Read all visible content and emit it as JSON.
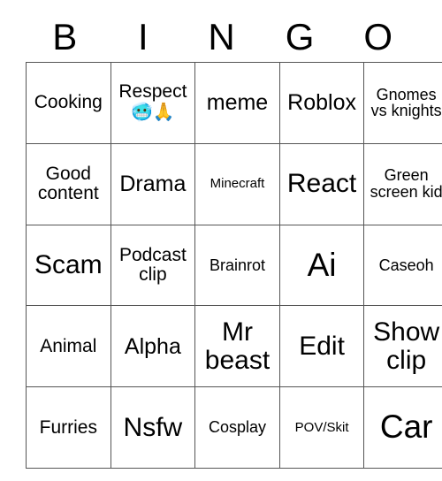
{
  "card": {
    "header_letters": [
      "B",
      "I",
      "N",
      "G",
      "O"
    ],
    "rows": [
      [
        {
          "text": "Cooking",
          "size": "fs-m",
          "emoji": ""
        },
        {
          "text": "Respect",
          "size": "fs-m",
          "emoji": "🥶🙏"
        },
        {
          "text": "meme",
          "size": "fs-l",
          "emoji": ""
        },
        {
          "text": "Roblox",
          "size": "fs-l",
          "emoji": ""
        },
        {
          "text": "Gnomes vs knights",
          "size": "fs-s",
          "emoji": ""
        }
      ],
      [
        {
          "text": "Good content",
          "size": "fs-m",
          "emoji": ""
        },
        {
          "text": "Drama",
          "size": "fs-l",
          "emoji": ""
        },
        {
          "text": "Minecraft",
          "size": "fs-xs",
          "emoji": ""
        },
        {
          "text": "React",
          "size": "fs-xl",
          "emoji": ""
        },
        {
          "text": "Green screen kid",
          "size": "fs-s",
          "emoji": ""
        }
      ],
      [
        {
          "text": "Scam",
          "size": "fs-xl",
          "emoji": ""
        },
        {
          "text": "Podcast clip",
          "size": "fs-m",
          "emoji": ""
        },
        {
          "text": "Brainrot",
          "size": "fs-s",
          "emoji": ""
        },
        {
          "text": "Ai",
          "size": "fs-xxl",
          "emoji": ""
        },
        {
          "text": "Caseoh",
          "size": "fs-s",
          "emoji": ""
        }
      ],
      [
        {
          "text": "Animal",
          "size": "fs-m",
          "emoji": ""
        },
        {
          "text": "Alpha",
          "size": "fs-l",
          "emoji": ""
        },
        {
          "text": "Mr beast",
          "size": "fs-xl",
          "emoji": ""
        },
        {
          "text": "Edit",
          "size": "fs-xl",
          "emoji": ""
        },
        {
          "text": "Show clip",
          "size": "fs-xl",
          "emoji": ""
        }
      ],
      [
        {
          "text": "Furries",
          "size": "fs-m",
          "emoji": ""
        },
        {
          "text": "Nsfw",
          "size": "fs-xl",
          "emoji": ""
        },
        {
          "text": "Cosplay",
          "size": "fs-s",
          "emoji": ""
        },
        {
          "text": "POV/Skit",
          "size": "fs-xs",
          "emoji": ""
        },
        {
          "text": "Car",
          "size": "fs-xxl",
          "emoji": ""
        }
      ]
    ]
  },
  "colors": {
    "grid_line": "#555555",
    "background": "#ffffff",
    "text": "#000000"
  }
}
